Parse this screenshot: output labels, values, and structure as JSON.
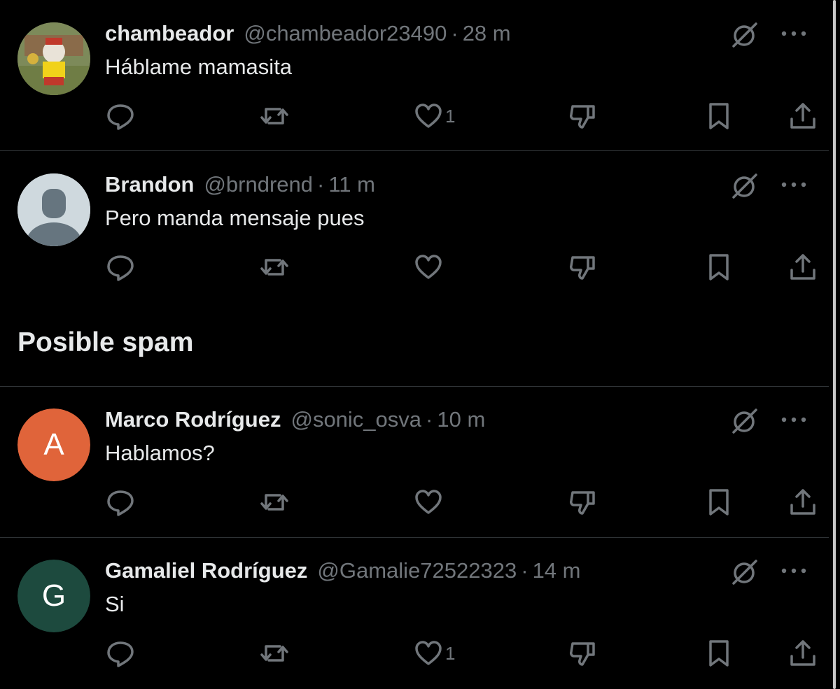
{
  "tweets": [
    {
      "name": "chambeador",
      "handle": "@chambeador23490",
      "separator": "·",
      "time": "28 m",
      "text": "Háblame mamasita",
      "avatar_type": "photo",
      "likes": "1"
    },
    {
      "name": "Brandon",
      "handle": "@brndrend",
      "separator": "·",
      "time": "11 m",
      "text": "Pero manda mensaje pues",
      "avatar_type": "default-silhouette",
      "likes": ""
    },
    {
      "name": "Marco Rodríguez",
      "handle": "@sonic_osva",
      "separator": "·",
      "time": "10 m",
      "text": "Hablamos?",
      "avatar_type": "letter",
      "avatar_letter": "A",
      "avatar_color": "#e0643a",
      "likes": ""
    },
    {
      "name": "Gamaliel Rodríguez",
      "handle": "@Gamalie72522323",
      "separator": "·",
      "time": "14 m",
      "text": "Si",
      "avatar_type": "letter",
      "avatar_letter": "G",
      "avatar_color": "#1d4a3e",
      "likes": "1"
    }
  ],
  "section": {
    "title": "Posible spam"
  },
  "icons": {
    "reply": "reply-icon",
    "retweet": "retweet-icon",
    "like": "like-icon",
    "dislike": "dislike-icon",
    "bookmark": "bookmark-icon",
    "share": "share-icon",
    "grok": "grok-icon",
    "more": "more-icon"
  },
  "colors": {
    "background": "#000000",
    "text": "#e7e9ea",
    "muted": "#71767b",
    "divider": "#2f3336"
  }
}
